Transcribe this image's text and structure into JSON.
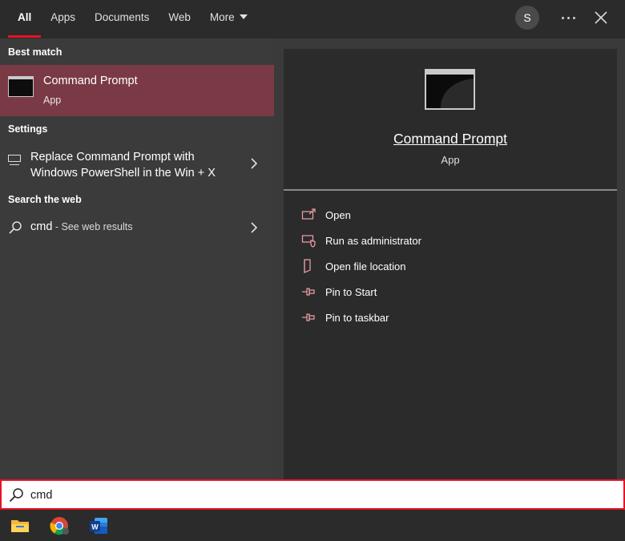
{
  "tabs": [
    {
      "label": "All",
      "active": true
    },
    {
      "label": "Apps"
    },
    {
      "label": "Documents"
    },
    {
      "label": "Web"
    },
    {
      "label": "More"
    }
  ],
  "header": {
    "avatar_initial": "S"
  },
  "sections": {
    "best_match": "Best match",
    "settings": "Settings",
    "search_web": "Search the web"
  },
  "best_match": {
    "title": "Command Prompt",
    "subtitle": "App"
  },
  "settings_item": {
    "line1": "Replace Command Prompt with",
    "line2": "Windows PowerShell in the Win + X"
  },
  "web_item": {
    "query": "cmd",
    "suffix": " - See web results"
  },
  "detail": {
    "title": "Command Prompt",
    "subtitle": "App",
    "actions": [
      {
        "label": "Open",
        "icon": "open-icon"
      },
      {
        "label": "Run as administrator",
        "icon": "shield-icon"
      },
      {
        "label": "Open file location",
        "icon": "file-location-icon"
      },
      {
        "label": "Pin to Start",
        "icon": "pin-icon"
      },
      {
        "label": "Pin to taskbar",
        "icon": "pin-icon"
      }
    ]
  },
  "search": {
    "value": "cmd"
  },
  "taskbar": {
    "apps": [
      "file-explorer-icon",
      "chrome-icon",
      "word-icon"
    ]
  },
  "colors": {
    "accent": "#e81123",
    "selected": "#7a3a45",
    "action_icon": "#f4a0a8"
  }
}
